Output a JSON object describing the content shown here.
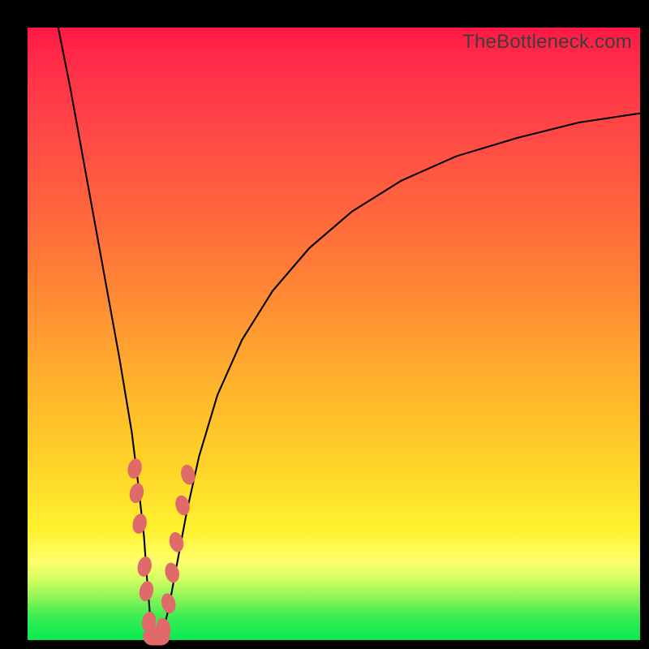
{
  "watermark": "TheBottleneck.com",
  "colors": {
    "frame": "#000000",
    "marker": "#e06a6a",
    "curve": "#000000"
  },
  "chart_data": {
    "type": "line",
    "title": "",
    "xlabel": "",
    "ylabel": "",
    "xlim": [
      0,
      100
    ],
    "ylim": [
      0,
      100
    ],
    "note": "Chart has no visible tick labels or axis labels; x and y are normalized 0-100.",
    "series": [
      {
        "name": "bottleneck-curve",
        "x": [
          5,
          7,
          9,
          11,
          13,
          15,
          17,
          18,
          19,
          19.5,
          20,
          20.5,
          21,
          22,
          23,
          24.5,
          26,
          28,
          31,
          35,
          40,
          46,
          53,
          61,
          70,
          80,
          90,
          100
        ],
        "y": [
          100,
          90,
          79,
          68,
          57,
          46,
          34,
          26,
          17,
          10,
          4,
          1,
          0,
          1,
          5,
          13,
          21,
          30,
          40,
          49,
          57,
          64,
          70,
          75,
          79,
          82,
          84.5,
          86
        ]
      }
    ],
    "markers": {
      "name": "highlight-points",
      "points": [
        {
          "x": 17.5,
          "y": 28
        },
        {
          "x": 17.8,
          "y": 24
        },
        {
          "x": 18.3,
          "y": 19
        },
        {
          "x": 19.1,
          "y": 12
        },
        {
          "x": 19.4,
          "y": 8
        },
        {
          "x": 19.8,
          "y": 3
        },
        {
          "x": 20.4,
          "y": 0.8
        },
        {
          "x": 21.2,
          "y": 0.5
        },
        {
          "x": 22.2,
          "y": 2
        },
        {
          "x": 23.0,
          "y": 6
        },
        {
          "x": 23.6,
          "y": 11
        },
        {
          "x": 24.3,
          "y": 16
        },
        {
          "x": 25.3,
          "y": 22
        },
        {
          "x": 26.2,
          "y": 27
        }
      ]
    }
  }
}
